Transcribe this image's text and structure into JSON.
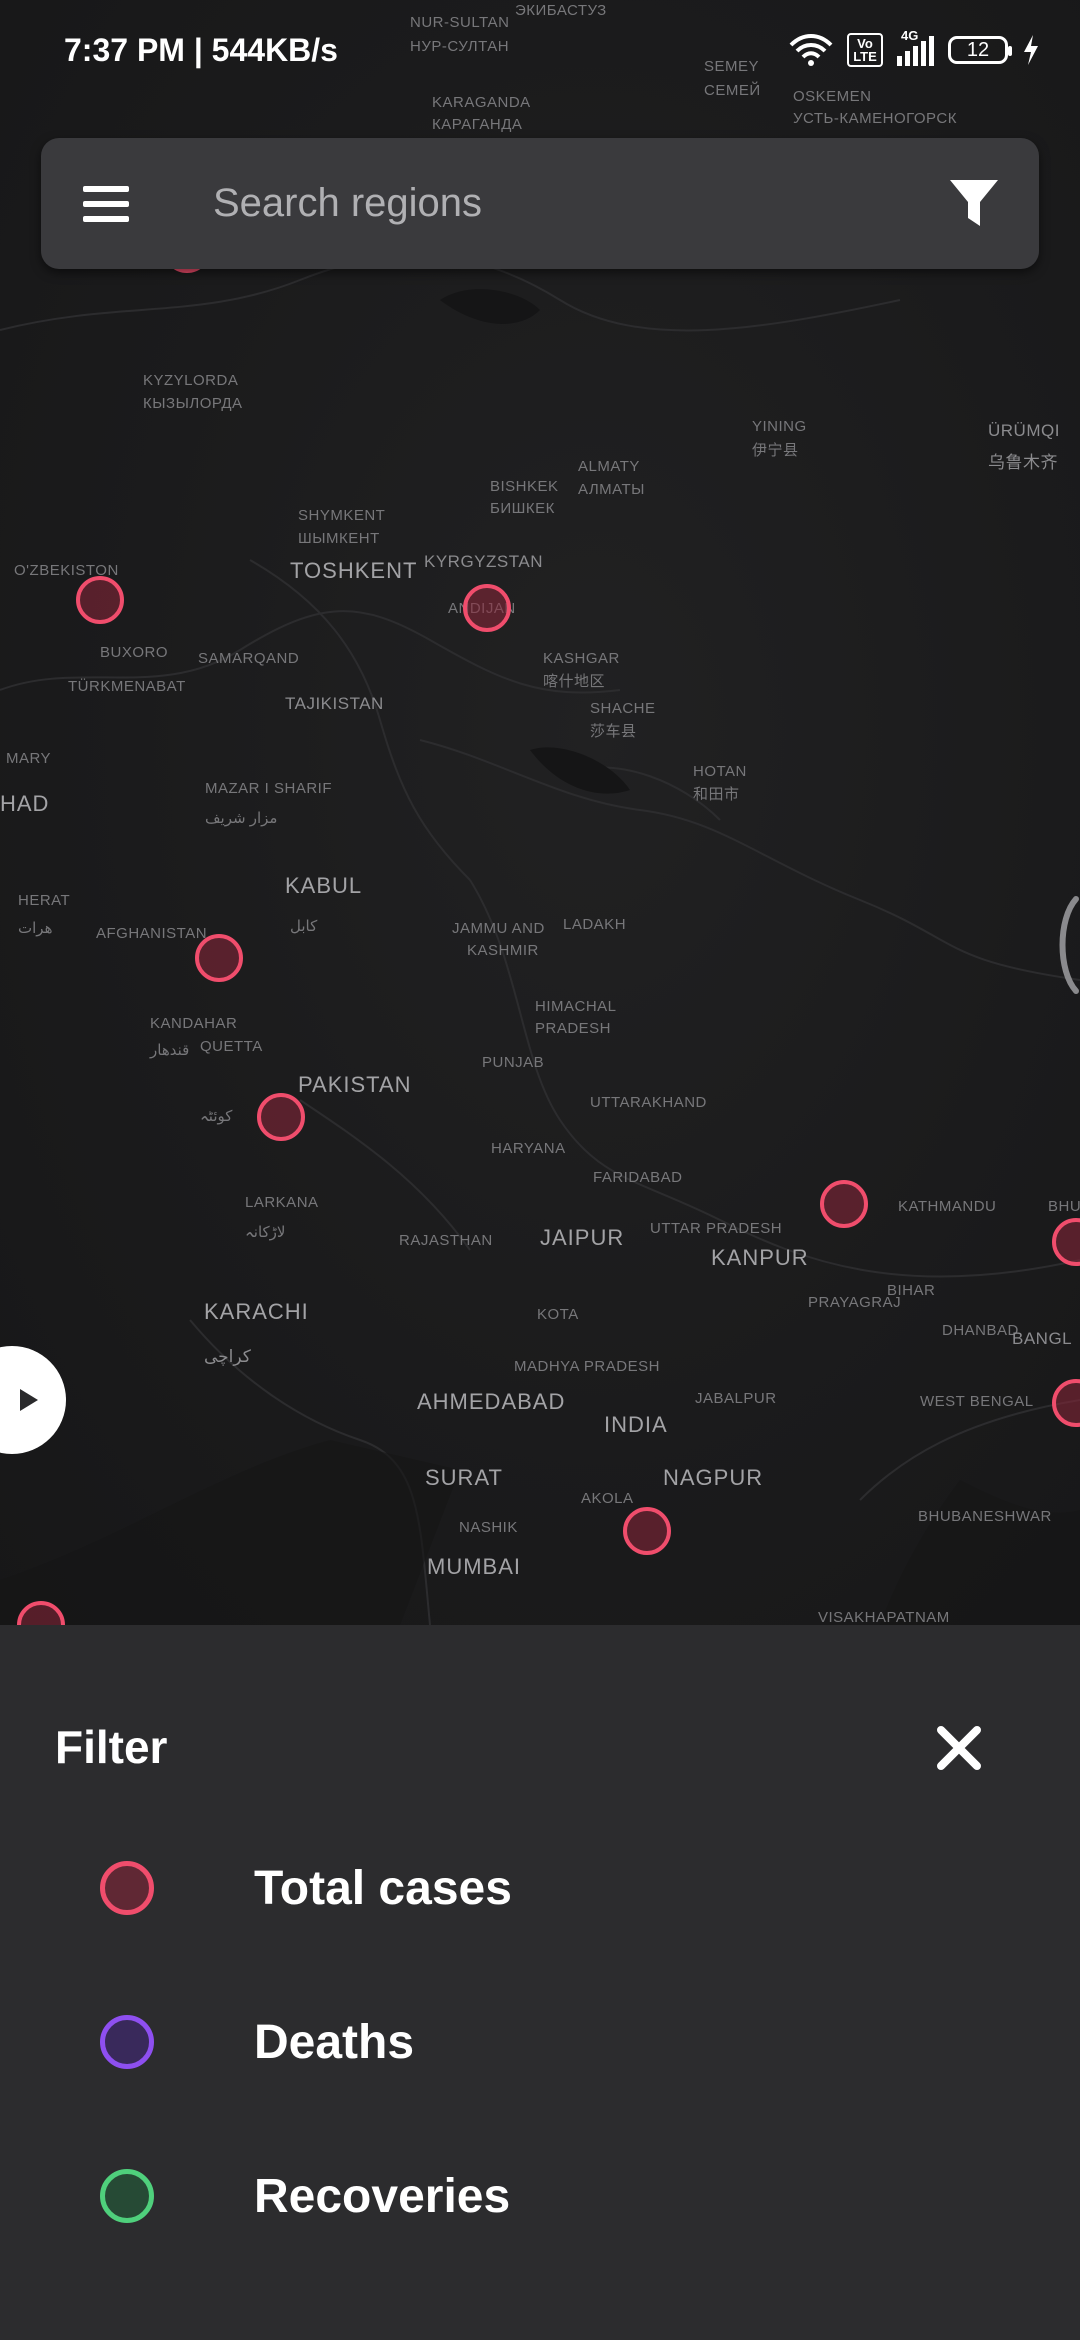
{
  "status_bar": {
    "time": "7:37 PM | 544KB/s",
    "network": "4G",
    "volte": "Vo LTE",
    "battery": "12"
  },
  "search": {
    "placeholder": "Search regions"
  },
  "map": {
    "labels": [
      "NUR-SULTAN",
      "НУР-СУЛТАН",
      "ЭКИБАСТУЗ",
      "SEMEY",
      "СЕМЕЙ",
      "OSKEMEN",
      "УСТЬ-КАМЕНОГОРСК",
      "KARAGANDA",
      "КАРАГАНДА",
      "KYZYLORDA",
      "КЫЗЫЛОРДА",
      "YINING",
      "伊宁县",
      "ÜRÜMQI",
      "乌鲁木齐",
      "BISHKEK",
      "БИШКЕК",
      "ALMATY",
      "АЛМАТЫ",
      "SHYMKENT",
      "ШЫМКЕНТ",
      "O'ZBEKISTON",
      "TOSHKENT",
      "KYRGYZSTAN",
      "ANDIJAN",
      "BUXORO",
      "SAMARQAND",
      "KASHGAR",
      "喀什地区",
      "TÜRKMENABAT",
      "TAJIKISTAN",
      "SHACHE",
      "莎车县",
      "MARY",
      "HAD",
      "HOTAN",
      "和田市",
      "MAZAR I SHARIF",
      "مزار شریف",
      "KABUL",
      "کابل",
      "HERAT",
      "هرات",
      "AFGHANISTAN",
      "JAMMU AND",
      "KASHMIR",
      "LADAKH",
      "HIMACHAL",
      "PRADESH",
      "KANDAHAR",
      "قندهار",
      "PAKISTAN",
      "QUETTA",
      "کوئٹہ",
      "PUNJAB",
      "UTTARAKHAND",
      "HARYANA",
      "FARIDABAD",
      "LARKANA",
      "لاڑکانہ",
      "RAJASTHAN",
      "JAIPUR",
      "UTTAR PRADESH",
      "KANPUR",
      "KATHMANDU",
      "BHU",
      "PRAYAGRAJ",
      "BIHAR",
      "KARACHI",
      "کراچی",
      "KOTA",
      "MADHYA PRADESH",
      "DHANBAD",
      "BANGL",
      "WEST BENGAL",
      "AHMEDABAD",
      "JABALPUR",
      "INDIA",
      "SURAT",
      "AKOLA",
      "NAGPUR",
      "NASHIK",
      "BHUBANESHWAR",
      "MUMBAI",
      "VISAKHAPATNAM"
    ]
  },
  "filter_sheet": {
    "title": "Filter",
    "options": [
      {
        "label": "Total cases",
        "color": "#f04d6c"
      },
      {
        "label": "Deaths",
        "color": "#8e4ff0"
      },
      {
        "label": "Recoveries",
        "color": "#4fd07c"
      }
    ]
  },
  "colors": {
    "map_bg": "#1b1b1c",
    "sheet_bg": "#2c2c2e",
    "search_bg": "#3a3a3d",
    "marker": "#f04d6c"
  }
}
